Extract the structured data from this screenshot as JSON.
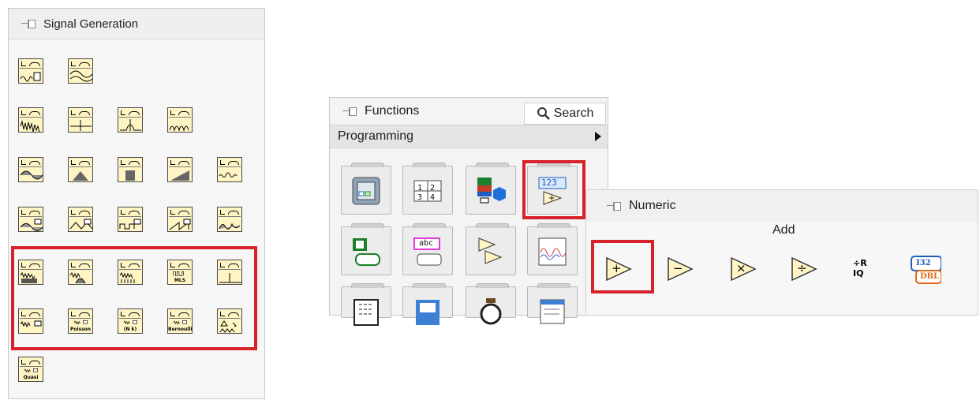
{
  "signal_palette": {
    "title": "Signal Generation",
    "rows": [
      [
        {
          "icon": "chirp-pattern-icon"
        },
        {
          "icon": "sine-wave-icon"
        }
      ],
      [
        {
          "icon": "white-noise-icon"
        },
        {
          "icon": "impulse-icon"
        },
        {
          "icon": "gaussian-pulse-icon"
        },
        {
          "icon": "pulse-train-icon"
        }
      ],
      [
        {
          "icon": "sine-pattern-icon"
        },
        {
          "icon": "triangle-pattern-icon"
        },
        {
          "icon": "square-pulse-icon"
        },
        {
          "icon": "ramp-pattern-icon"
        },
        {
          "icon": "sinc-pattern-icon"
        }
      ],
      [
        {
          "icon": "sine-waveform-icon"
        },
        {
          "icon": "triangle-waveform-icon"
        },
        {
          "icon": "square-waveform-icon"
        },
        {
          "icon": "sawtooth-waveform-icon"
        },
        {
          "icon": "arbitrary-waveform-icon"
        }
      ],
      [
        {
          "icon": "uniform-noise-icon"
        },
        {
          "icon": "gaussian-noise-icon"
        },
        {
          "icon": "periodic-random-noise-icon"
        },
        {
          "icon": "mls-sequence-icon",
          "label": "MLS"
        },
        {
          "icon": "impulse-pattern-icon"
        }
      ],
      [
        {
          "icon": "gamma-noise-icon"
        },
        {
          "icon": "poisson-noise-icon",
          "label": "Poisson"
        },
        {
          "icon": "binomial-noise-icon",
          "label": "(N k)"
        },
        {
          "icon": "bernoulli-noise-icon",
          "label": "Bernoulli"
        },
        {
          "icon": "random-state-icon"
        }
      ],
      [
        {
          "icon": "quasi-random-icon",
          "label": "Quasi"
        }
      ]
    ]
  },
  "functions_palette": {
    "title": "Functions",
    "search_label": "Search",
    "category": "Programming",
    "tiles": [
      {
        "icon": "structures-icon"
      },
      {
        "icon": "array-icon",
        "text": "1 2 3 4"
      },
      {
        "icon": "cluster-icon"
      },
      {
        "icon": "numeric-icon",
        "text": "123"
      },
      {
        "icon": "boolean-icon"
      },
      {
        "icon": "string-icon",
        "text": "abc"
      },
      {
        "icon": "comparison-icon"
      },
      {
        "icon": "timing-waveform-icon"
      },
      {
        "icon": "application-control-icon"
      },
      {
        "icon": "file-io-icon"
      },
      {
        "icon": "timing-icon"
      },
      {
        "icon": "dialog-ui-icon"
      }
    ]
  },
  "numeric_palette": {
    "title": "Numeric",
    "hover_label": "Add",
    "items": [
      {
        "icon": "add-icon",
        "symbol": "+"
      },
      {
        "icon": "subtract-icon",
        "symbol": "−"
      },
      {
        "icon": "multiply-icon",
        "symbol": "×"
      },
      {
        "icon": "divide-icon",
        "symbol": "÷"
      },
      {
        "icon": "quotient-remainder-icon",
        "symbol": "÷R IQ"
      },
      {
        "icon": "conversion-icon",
        "top": "I32",
        "bottom": "DBL"
      }
    ]
  },
  "colors": {
    "highlight": "#d8222b",
    "vi_bg": "#fff5c4",
    "numeric_blue": "#1d5fb8"
  }
}
